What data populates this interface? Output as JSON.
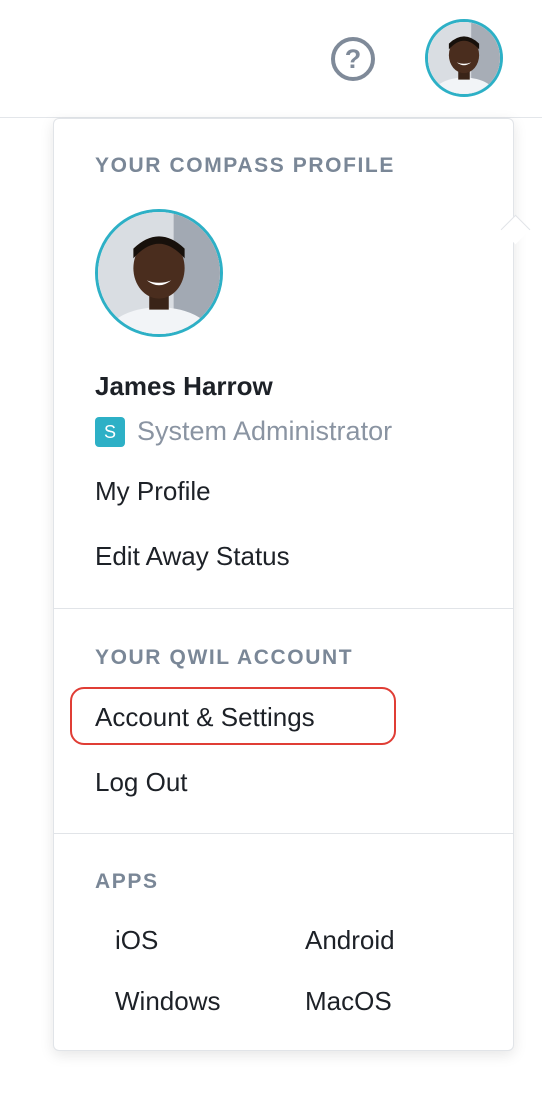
{
  "header": {
    "help_icon": "help-circle-icon",
    "avatar_label": "user-avatar"
  },
  "profile_menu": {
    "section_title": "YOUR COMPASS PROFILE",
    "user_name": "James Harrow",
    "role_badge": "S",
    "role": "System Administrator",
    "items": [
      "My Profile",
      "Edit Away Status"
    ]
  },
  "account_menu": {
    "section_title": "YOUR QWIL ACCOUNT",
    "items": [
      "Account & Settings",
      "Log Out"
    ]
  },
  "apps_menu": {
    "section_title": "APPS",
    "items": [
      "iOS",
      "Android",
      "Windows",
      "MacOS"
    ]
  },
  "colors": {
    "accent": "#2db0c6",
    "highlight": "#e03d35",
    "muted_text": "#7a8797"
  }
}
